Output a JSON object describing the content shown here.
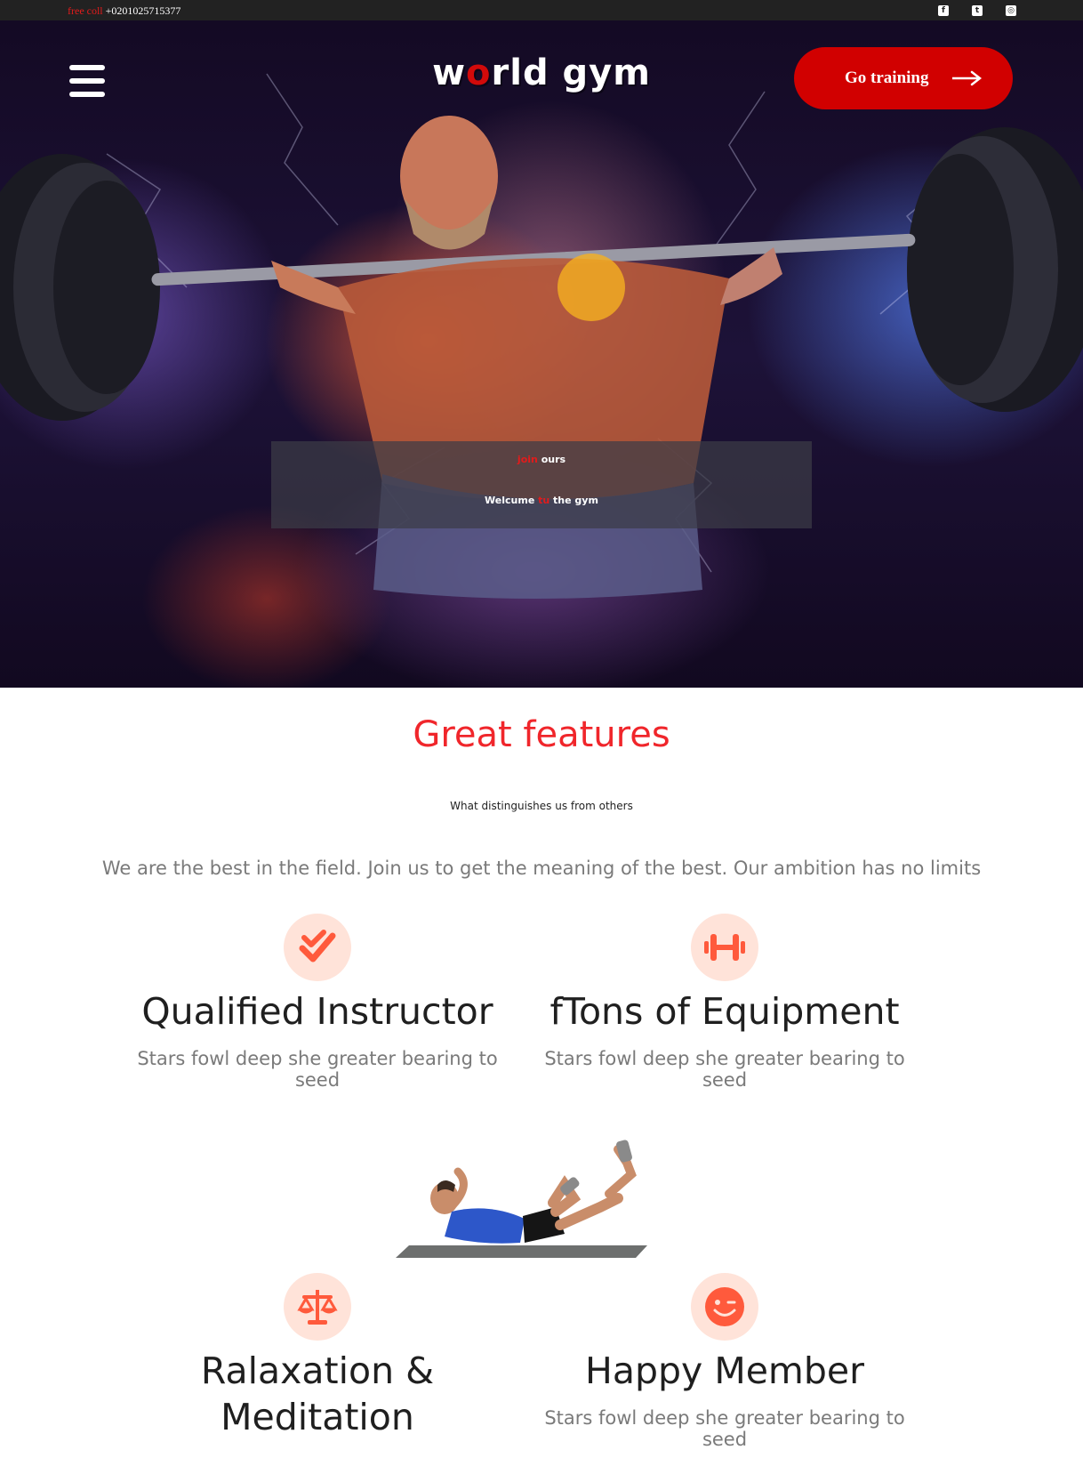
{
  "topbar": {
    "phone_prefix": "free coll",
    "phone_number": "+0201025715377",
    "social": [
      {
        "icon": "facebook-icon",
        "glyph": "f"
      },
      {
        "icon": "twitter-icon",
        "glyph": "t"
      },
      {
        "icon": "instagram-icon",
        "glyph": "◎"
      }
    ]
  },
  "header": {
    "logo_w": "w",
    "logo_o": "o",
    "logo_rest": "rld gym",
    "cta_label": "Go training"
  },
  "hero": {
    "join_highlight": "join",
    "join_rest": " ours",
    "welcome_start": "Welcume ",
    "welcome_highlight": "tu",
    "welcome_end": " the gym"
  },
  "features": {
    "title": "Great features",
    "subtitle": "What distinguishes us from others",
    "lead": "We are the best in the field. Join us to get the meaning of the best. Our ambition has no limits",
    "cards": [
      {
        "icon": "checkmark-icon",
        "title": "Qualified Instructor",
        "text": "Stars fowl deep she greater bearing to seed"
      },
      {
        "icon": "dumbbell-icon",
        "title": "fTons of Equipment",
        "text": "Stars fowl deep she greater bearing to seed"
      },
      {
        "icon": "scale-icon",
        "title_line1": "Ralaxation &",
        "title_line2": "Meditation"
      },
      {
        "icon": "smile-icon",
        "title": "Happy Member",
        "text": "Stars fowl deep she greater bearing to seed"
      }
    ]
  },
  "colors": {
    "accent_red": "#d10000",
    "title_red": "#f0262b",
    "icon_bg": "#ffe3d9",
    "icon_fg": "#ff5a3c",
    "topbar_bg": "#222222"
  }
}
